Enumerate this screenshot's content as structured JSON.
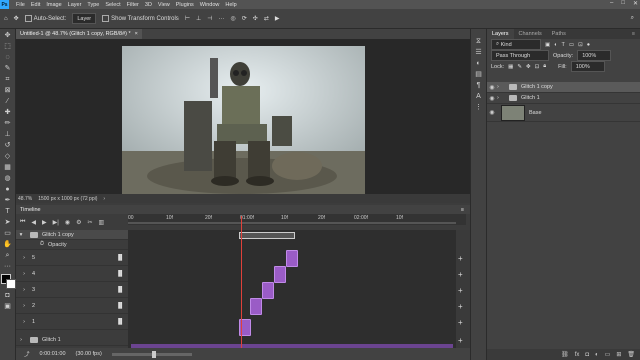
{
  "menu": {
    "app_logo": "Ps",
    "items": [
      "File",
      "Edit",
      "Image",
      "Layer",
      "Type",
      "Select",
      "Filter",
      "3D",
      "View",
      "Plugins",
      "Window",
      "Help"
    ],
    "window_controls": [
      "–",
      "□",
      "✕"
    ]
  },
  "options_bar": {
    "auto_select_label": "Auto-Select:",
    "auto_select_value": "Layer",
    "show_transform_label": "Show Transform Controls"
  },
  "document": {
    "tab_title": "Untitled-1 @ 48.7% (Glitch 1 copy, RGB/8#) *",
    "zoom": "48.7%",
    "size_info": "1500 px x 1000 px (72 ppi)"
  },
  "timeline": {
    "title": "Timeline",
    "ruler_labels": [
      "00",
      "10f",
      "20f",
      "01:00f",
      "10f",
      "20f",
      "02:00f",
      "10f"
    ],
    "playhead_fraction": 0.345,
    "tracks": [
      {
        "label": "Glitch 1 copy",
        "kind": "group"
      },
      {
        "label": "Opacity",
        "kind": "property"
      },
      {
        "label": "5",
        "kind": "layer"
      },
      {
        "label": "4",
        "kind": "layer"
      },
      {
        "label": "3",
        "kind": "layer"
      },
      {
        "label": "2",
        "kind": "layer"
      },
      {
        "label": "1",
        "kind": "layer"
      },
      {
        "label": "Glitch 1",
        "kind": "group"
      }
    ],
    "current_time": "0:00:01:00",
    "fps": "(30.00 fps)"
  },
  "layers_panel": {
    "tabs": [
      "Layers",
      "Channels",
      "Paths"
    ],
    "kind_filter": "Kind",
    "blend_mode": "Pass Through",
    "opacity_label": "Opacity:",
    "opacity_value": "100%",
    "lock_label": "Lock:",
    "fill_label": "Fill:",
    "fill_value": "100%",
    "layers": [
      {
        "name": "Glitch 1 copy",
        "type": "group",
        "selected": true
      },
      {
        "name": "Glitch 1",
        "type": "group",
        "selected": false
      },
      {
        "name": "Base",
        "type": "image",
        "selected": false
      }
    ]
  },
  "colors": {
    "accent": "#31a8ff",
    "clip": "#9a5cc6",
    "playhead": "#e0413a"
  }
}
